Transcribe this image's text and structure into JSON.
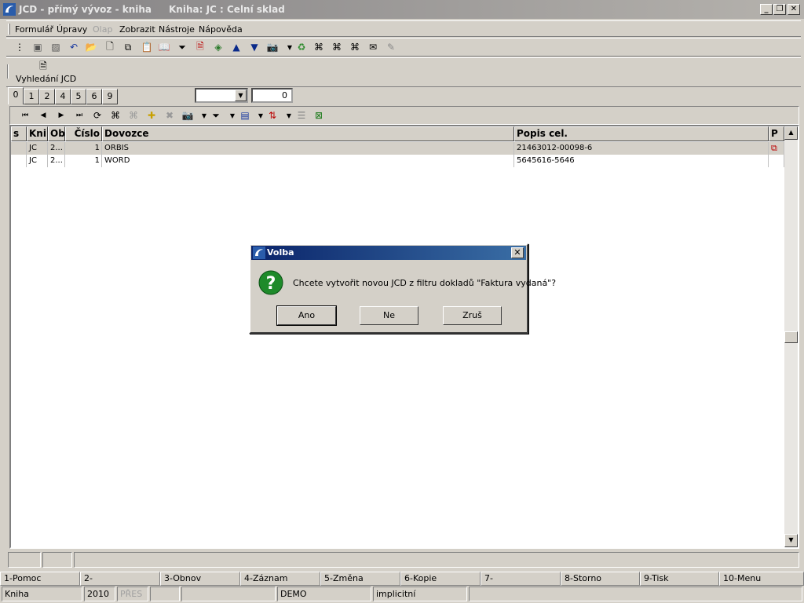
{
  "window": {
    "title": "JCD - přímý vývoz - kniha",
    "subtitle": "Kniha: JC : Celní sklad"
  },
  "menu": [
    "Formulář",
    "Úpravy",
    "Olap",
    "Zobrazit",
    "Nástroje",
    "Nápověda"
  ],
  "menu_disabled": [
    "Olap"
  ],
  "toolbar2": {
    "button_label": "Vyhledání JCD"
  },
  "tabs": [
    "0",
    "1",
    "2",
    "4",
    "5",
    "6",
    "9"
  ],
  "active_tab": "0",
  "combo": {
    "value": ""
  },
  "number_field": {
    "value": "0"
  },
  "grid": {
    "columns": [
      "s",
      "Knih",
      "Ob",
      "Číslo",
      "Dovozce",
      "Popis cel.",
      "P"
    ],
    "rows": [
      {
        "s": "",
        "kniha": "JC",
        "ob": "2...",
        "cislo": "1",
        "dovozce": "ORBIS",
        "popis": "21463012-00098-6",
        "selected": true,
        "has_icon": true
      },
      {
        "s": "",
        "kniha": "JC",
        "ob": "2...",
        "cislo": "1",
        "dovozce": "WORD",
        "popis": "5645616-5646",
        "selected": false,
        "has_icon": false
      }
    ]
  },
  "function_keys": [
    "1-Pomoc",
    "2-",
    "3-Obnov",
    "4-Záznam",
    "5-Změna",
    "6-Kopie",
    "7-",
    "8-Storno",
    "9-Tisk",
    "10-Menu"
  ],
  "statusbar": {
    "mode": "Kniha",
    "year": "2010",
    "overwrite": "PŘES",
    "db": "DEMO",
    "profile": "implicitní"
  },
  "dialog": {
    "title": "Volba",
    "message": "Chcete vytvořit novou JCD z filtru dokladů \"Faktura vydaná\"?",
    "buttons": {
      "yes": "Ano",
      "no": "Ne",
      "cancel": "Zruš"
    }
  },
  "colors": {
    "titlebar_inactive": "#848284",
    "dialog_title": "#0a246a",
    "face": "#d4d0c8"
  }
}
